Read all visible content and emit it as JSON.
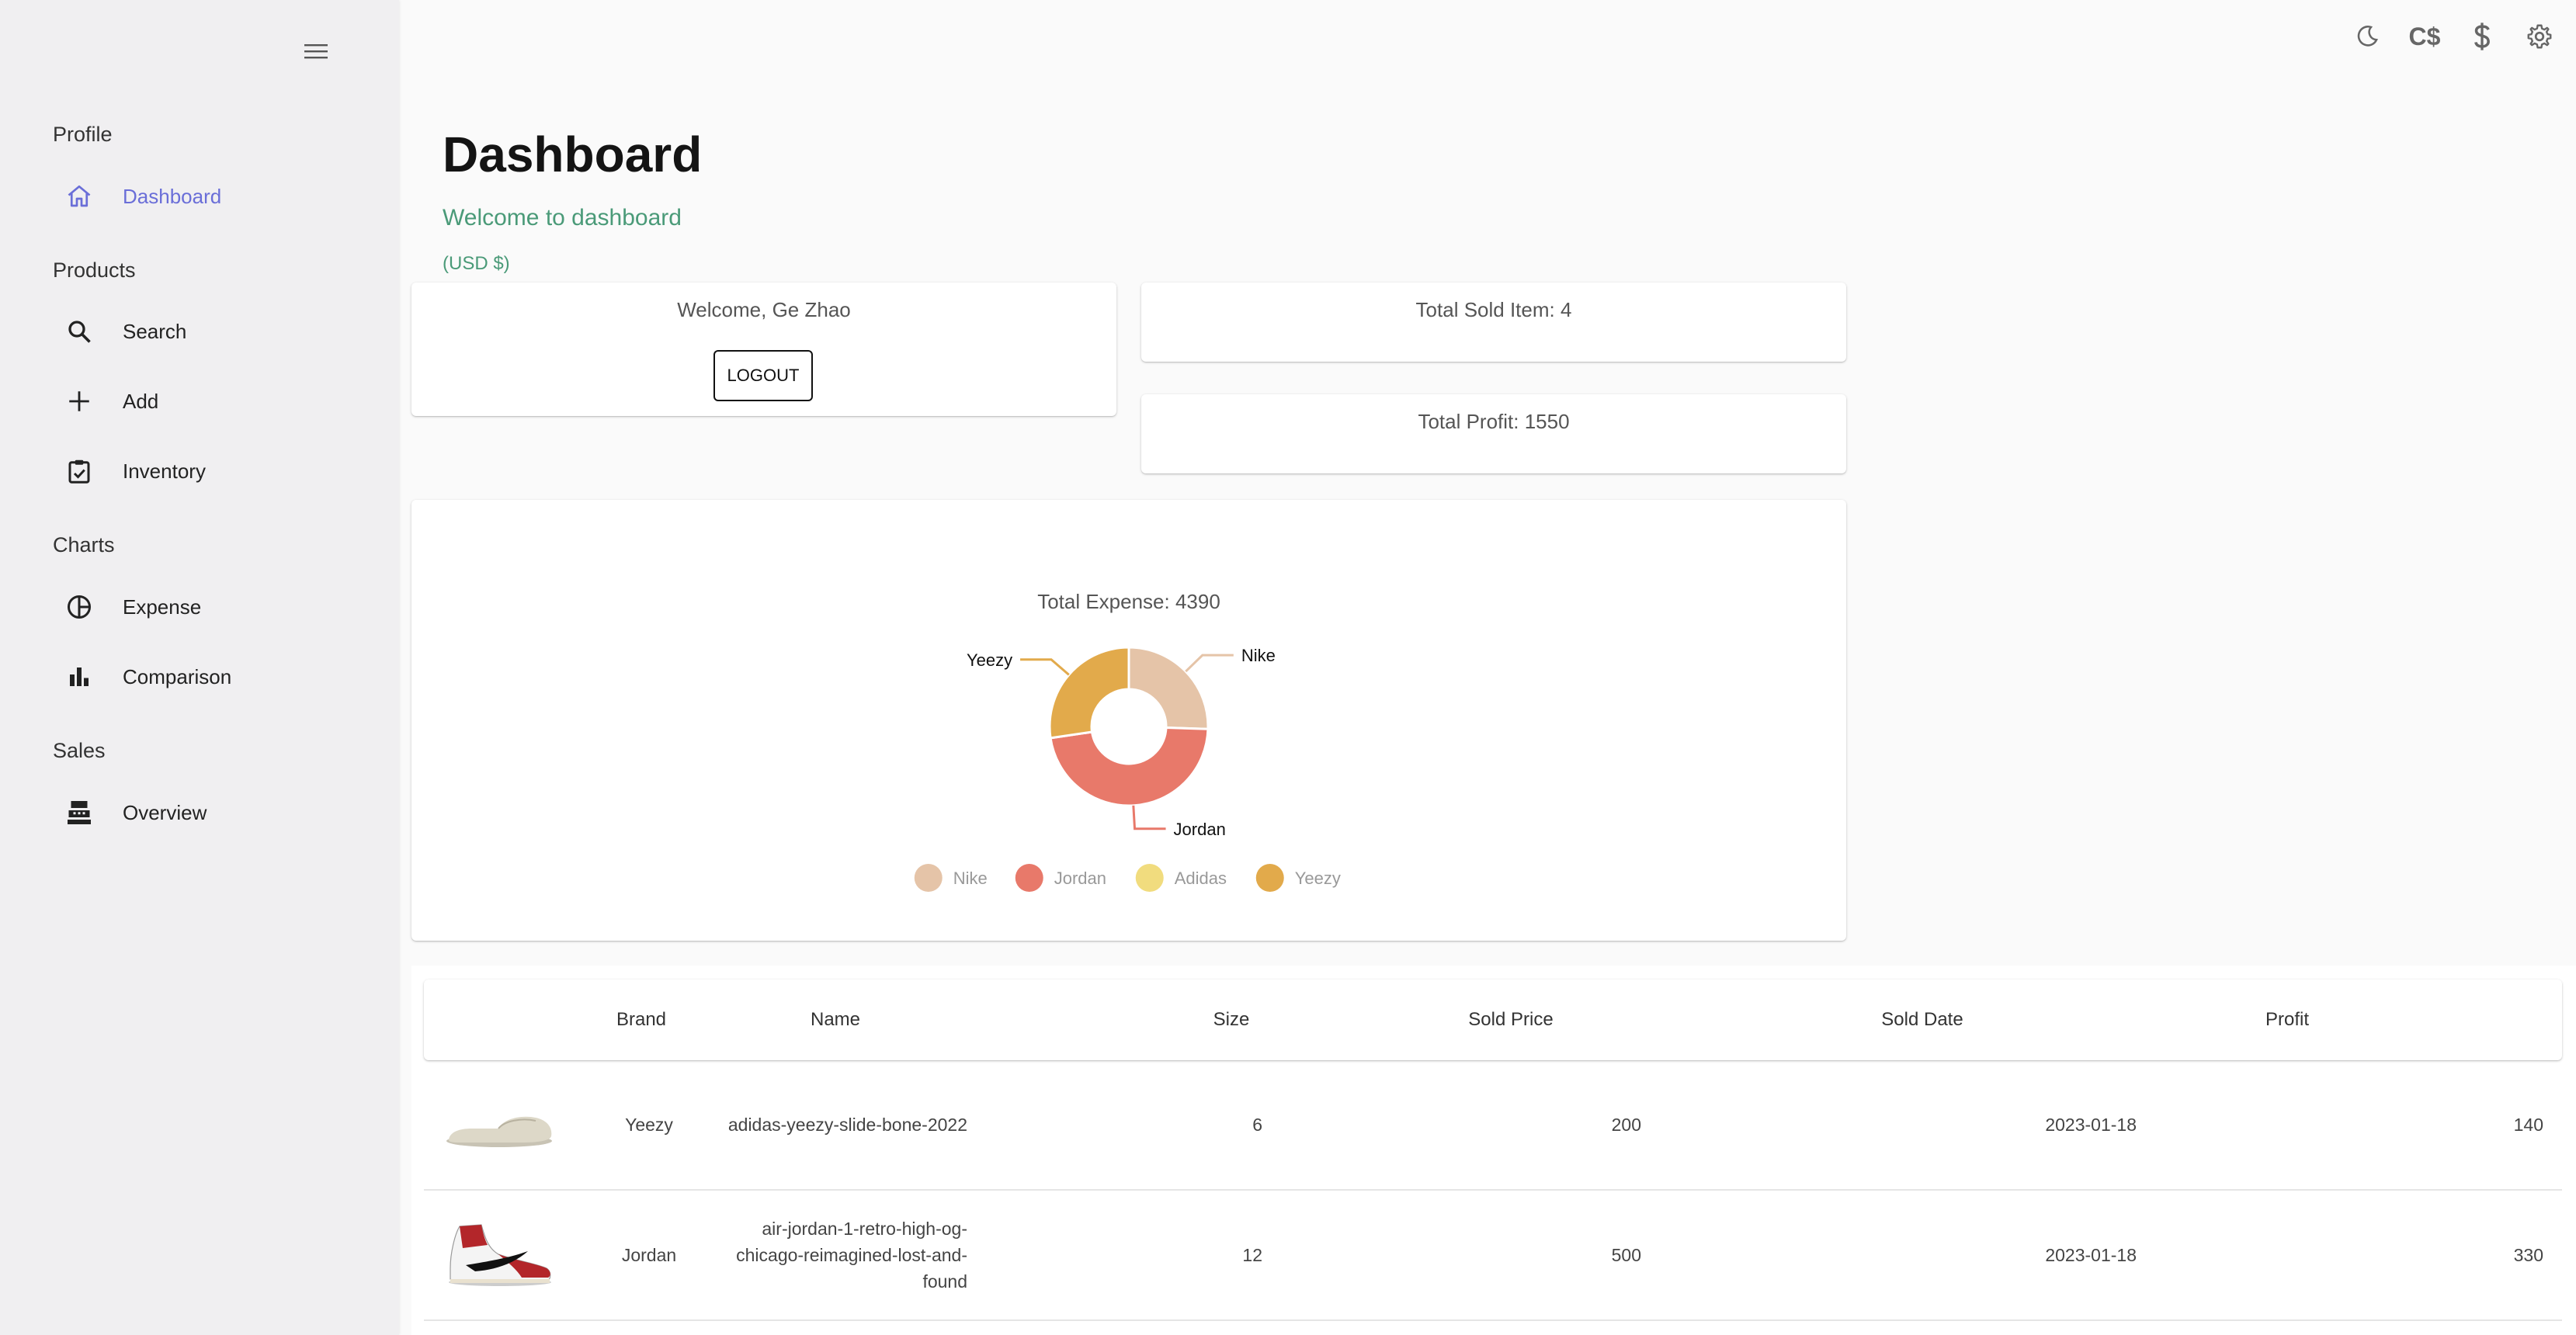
{
  "sidebar": {
    "sections": {
      "profile": "Profile",
      "products": "Products",
      "charts": "Charts",
      "sales": "Sales"
    },
    "items": {
      "dashboard": "Dashboard",
      "search": "Search",
      "add": "Add",
      "inventory": "Inventory",
      "expense": "Expense",
      "comparison": "Comparison",
      "overview": "Overview"
    },
    "active_color": "#6a6ed8"
  },
  "topbar": {
    "icons": [
      "moon-icon",
      "cad-currency-icon",
      "usd-currency-icon",
      "gear-icon"
    ],
    "cad_label": "C$"
  },
  "header": {
    "title": "Dashboard",
    "subtitle": "Welcome to dashboard",
    "currency": "(USD $)",
    "accent": "#4a9a78"
  },
  "cards": {
    "welcome": "Welcome, Ge Zhao",
    "logout": "LOGOUT",
    "total_sold": "Total Sold Item: 4",
    "total_profit": "Total Profit: 1550"
  },
  "chart_data": {
    "type": "pie",
    "title": "Total Expense: 4390",
    "series": [
      {
        "name": "Nike",
        "value": 1120,
        "color": "#e5c4a8"
      },
      {
        "name": "Jordan",
        "value": 2070,
        "color": "#e8796a"
      },
      {
        "name": "Adidas",
        "value": 0,
        "color": "#f1dc7e"
      },
      {
        "name": "Yeezy",
        "value": 1200,
        "color": "#e2aa4b"
      }
    ],
    "legend": "bottom",
    "labels_shown": [
      "Yeezy",
      "Nike",
      "Jordan"
    ]
  },
  "table": {
    "columns": [
      "Brand",
      "Name",
      "Size",
      "Sold Price",
      "Sold Date",
      "Profit"
    ],
    "rows": [
      {
        "image": "yeezy-slide-thumbnail",
        "brand": "Yeezy",
        "name": "adidas-yeezy-slide-bone-2022",
        "size": "6",
        "price": "200",
        "date": "2023-01-18",
        "profit": "140"
      },
      {
        "image": "jordan-1-thumbnail",
        "brand": "Jordan",
        "name": "air-jordan-1-retro-high-og-chicago-reimagined-lost-and-found",
        "size": "12",
        "price": "500",
        "date": "2023-01-18",
        "profit": "330"
      }
    ]
  }
}
